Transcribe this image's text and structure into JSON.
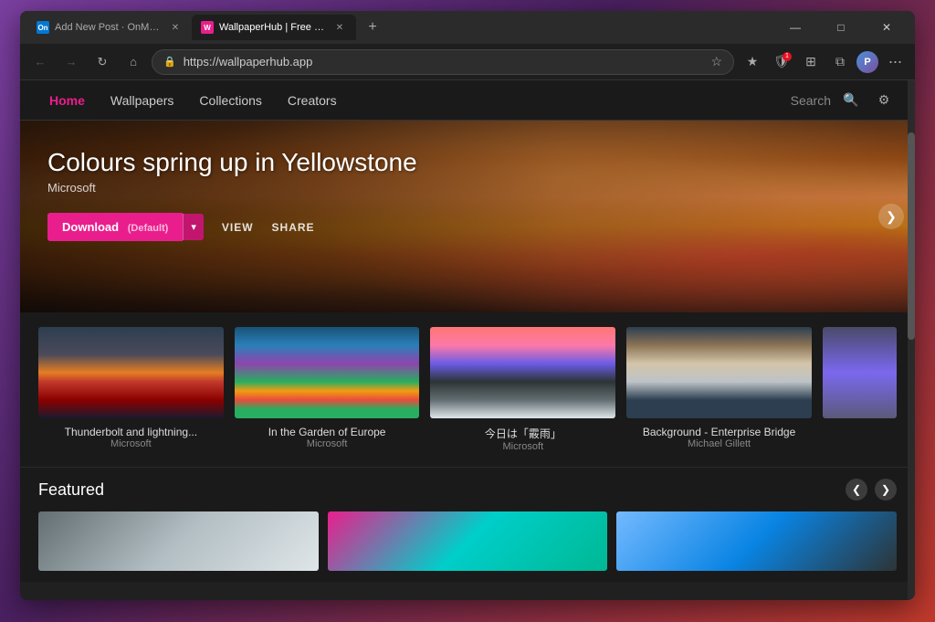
{
  "browser": {
    "tabs": [
      {
        "id": "tab-msft",
        "label": "Add New Post · OnMSFT.com — ...",
        "favicon_type": "msft",
        "favicon_label": "On",
        "active": false
      },
      {
        "id": "tab-wallpaper",
        "label": "WallpaperHub | Free wallpapers...",
        "favicon_type": "wph",
        "favicon_label": "W",
        "active": true
      }
    ],
    "new_tab_icon": "+",
    "window_controls": {
      "minimize": "—",
      "maximize": "□",
      "close": "✕"
    },
    "address_bar": {
      "url": "https://wallpaperhub.app",
      "lock_icon": "🔒"
    },
    "toolbar": {
      "star_icon": "☆",
      "extensions_icon": "⊞",
      "favorites_icon": "★",
      "collections_icon": "⧉",
      "more_icon": "···",
      "profile_initial": "P"
    }
  },
  "site": {
    "nav": {
      "links": [
        {
          "id": "home",
          "label": "Home",
          "active": true
        },
        {
          "id": "wallpapers",
          "label": "Wallpapers",
          "active": false
        },
        {
          "id": "collections",
          "label": "Collections",
          "active": false
        },
        {
          "id": "creators",
          "label": "Creators",
          "active": false
        }
      ],
      "search_placeholder": "Search",
      "search_icon": "🔍",
      "settings_icon": "⚙"
    },
    "hero": {
      "title": "Colours spring up in Yellowstone",
      "subtitle": "Microsoft",
      "download_label": "Download",
      "download_default": "(Default)",
      "dropdown_icon": "▾",
      "view_label": "VIEW",
      "share_label": "SHARE",
      "nav_right_icon": "❯"
    },
    "wallpapers": [
      {
        "id": "w1",
        "name": "Thunderbolt and lightning...",
        "creator": "Microsoft",
        "thumb_class": "thumb-thunderbolt"
      },
      {
        "id": "w2",
        "name": "In the Garden of Europe",
        "creator": "Microsoft",
        "thumb_class": "thumb-garden"
      },
      {
        "id": "w3",
        "name": "今日は「霰雨」",
        "creator": "Microsoft",
        "thumb_class": "thumb-japanese"
      },
      {
        "id": "w4",
        "name": "Background - Enterprise Bridge",
        "creator": "Michael Gillett",
        "thumb_class": "thumb-enterprise"
      }
    ],
    "featured": {
      "title": "Featured",
      "nav_prev": "❮",
      "nav_next": "❯",
      "cards": [
        {
          "id": "f1",
          "class": "feat-card-1"
        },
        {
          "id": "f2",
          "class": "feat-card-2"
        },
        {
          "id": "f3",
          "class": "feat-card-3"
        }
      ]
    }
  }
}
